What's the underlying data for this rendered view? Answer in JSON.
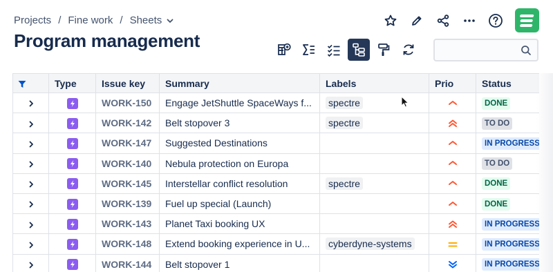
{
  "breadcrumb": {
    "items": [
      "Projects",
      "Fine work",
      "Sheets"
    ],
    "separator": "/"
  },
  "page_title": "Program management",
  "top_actions": [
    "star-icon",
    "pencil-icon",
    "share-icon",
    "more-icon",
    "help-icon"
  ],
  "app_logo_color": "#2fb56a",
  "toolbar": {
    "buttons": [
      "table-add-icon",
      "sigma-icon",
      "checklist-icon",
      "hierarchy-icon",
      "paint-roller-icon",
      "refresh-icon"
    ],
    "active": "hierarchy-icon"
  },
  "search": {
    "value": "",
    "placeholder": ""
  },
  "table": {
    "columns": [
      "",
      "Type",
      "Issue key",
      "Summary",
      "Labels",
      "Prio",
      "Status"
    ],
    "rows": [
      {
        "key": "WORK-150",
        "summary": "Engage JetShuttle SpaceWays f...",
        "label": "spectre",
        "prio": "medium",
        "status": "DONE",
        "status_kind": "done"
      },
      {
        "key": "WORK-142",
        "summary": "Belt stopover 3",
        "label": "spectre",
        "prio": "high",
        "status": "TO DO",
        "status_kind": "todo"
      },
      {
        "key": "WORK-147",
        "summary": "Suggested Destinations",
        "label": "",
        "prio": "medium",
        "status": "IN PROGRESS",
        "status_kind": "inprogress"
      },
      {
        "key": "WORK-140",
        "summary": "Nebula protection on Europa",
        "label": "",
        "prio": "medium",
        "status": "TO DO",
        "status_kind": "todo"
      },
      {
        "key": "WORK-145",
        "summary": "Interstellar conflict resolution",
        "label": "spectre",
        "prio": "medium",
        "status": "DONE",
        "status_kind": "done"
      },
      {
        "key": "WORK-139",
        "summary": "Fuel up special (Launch)",
        "label": "",
        "prio": "medium",
        "status": "DONE",
        "status_kind": "done"
      },
      {
        "key": "WORK-143",
        "summary": "Planet Taxi booking UX",
        "label": "",
        "prio": "high",
        "status": "IN PROGRESS",
        "status_kind": "inprogress"
      },
      {
        "key": "WORK-148",
        "summary": "Extend booking experience in U...",
        "label": "cyberdyne-systems",
        "prio": "equal",
        "status": "IN PROGRESS",
        "status_kind": "inprogress"
      },
      {
        "key": "WORK-144",
        "summary": "Belt stopover 1",
        "label": "",
        "prio": "low",
        "status": "IN PROGRESS",
        "status_kind": "inprogress"
      }
    ]
  },
  "colors": {
    "type_icon": "#8c5cf0",
    "prio_medium": "#ff5630",
    "prio_high": "#ff5630",
    "prio_equal": "#ffab00",
    "prio_low": "#0065ff",
    "filter_icon": "#0052cc"
  }
}
